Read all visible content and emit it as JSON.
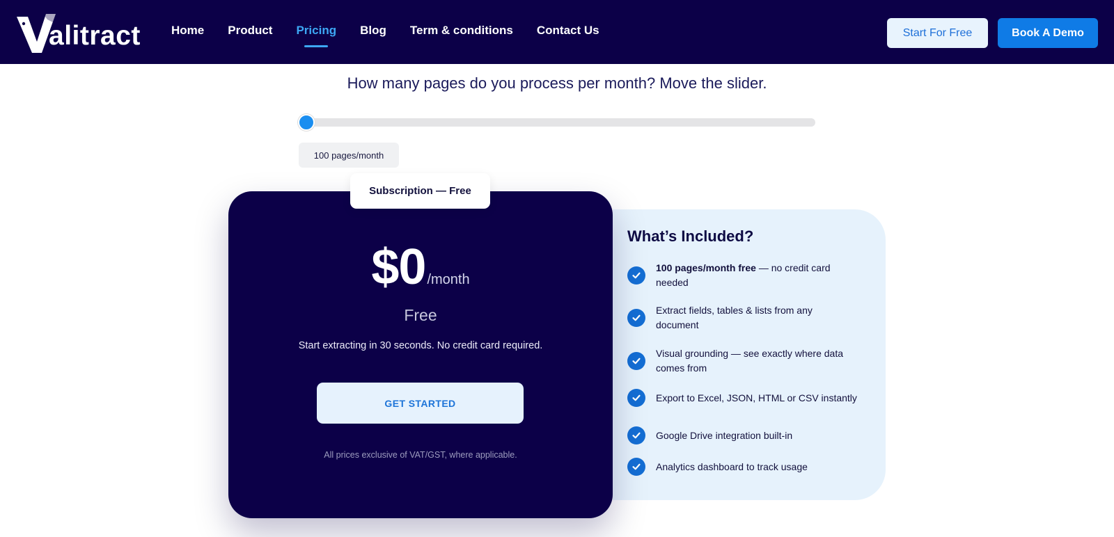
{
  "brand": {
    "name": "alitract"
  },
  "nav": {
    "links": [
      {
        "label": "Home"
      },
      {
        "label": "Product"
      },
      {
        "label": "Pricing"
      },
      {
        "label": "Blog"
      },
      {
        "label": "Term & conditions"
      },
      {
        "label": "Contact Us"
      }
    ],
    "active": "Pricing",
    "start_label": "Start For Free",
    "demo_label": "Book A Demo"
  },
  "slider": {
    "question": "How many pages do you process per month? Move the slider.",
    "value_label": "100 pages/month",
    "position_fraction": 0
  },
  "plan": {
    "tab_label": "Subscription — Free",
    "price": "$0",
    "period": "/month",
    "name": "Free",
    "description": "Start extracting in 30 seconds. No credit card required.",
    "cta_label": "GET STARTED",
    "note": "All prices exclusive of VAT/GST, where applicable."
  },
  "included": {
    "title": "What’s Included?",
    "features": [
      {
        "bold": "100 pages/month free",
        "text": " — no credit card needed"
      },
      {
        "bold": "",
        "text": "Extract fields, tables & lists from any document"
      },
      {
        "bold": "",
        "text": "Visual grounding — see exactly where data comes from"
      },
      {
        "bold": "",
        "text": "Export to Excel, JSON, HTML or CSV instantly"
      },
      {
        "bold": "",
        "text": "Google Drive integration built-in"
      },
      {
        "bold": "",
        "text": "Analytics dashboard to track usage"
      }
    ]
  },
  "colors": {
    "navy": "#0c0048",
    "accent_blue": "#0f7be6",
    "active_link": "#3da8f5",
    "slider_thumb": "#1a8ef0",
    "check": "#146ed4",
    "panel_bg": "#e6f2fc"
  },
  "icons": {
    "check": "check-icon",
    "logo": "logo-v-mark"
  }
}
